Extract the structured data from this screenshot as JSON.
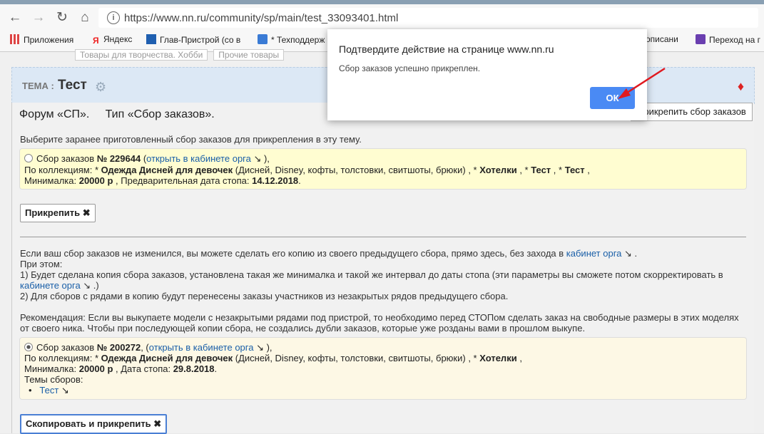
{
  "browser": {
    "url": "https://www.nn.ru/community/sp/main/test_33093401.html",
    "bookmarks": [
      "Приложения",
      "Яндекс",
      "Глав-Пристрой (со в",
      "* Техподдерж",
      "описани",
      "Переход на г"
    ]
  },
  "breadcrumbs": [
    "Товары для творчества. Хобби",
    "Прочие товары"
  ],
  "topic": {
    "label": "ТЕМА :",
    "title": "Тест"
  },
  "forum_line": "Форум «СП».     Тип «Сбор заказов».",
  "attach_top_button": "Прикрепить сбор заказов",
  "choose_text": "Выберите заранее приготовленный сбор заказов для прикрепления в эту тему.",
  "card1": {
    "l1a": "Сбор заказов ",
    "l1num": "№ 229644",
    "l1b": " (",
    "l1link": "открыть в кабинете орга",
    "l1c": " ↘ ),",
    "l2a": "По коллекциям: * ",
    "l2b1": "Одежда Дисней для девочек",
    "l2c": " (Дисней, Disney, кофты, толстовки, свитшоты, брюки) , * ",
    "l2b2": "Хотелки",
    "l2d": " , * ",
    "l2b3": "Тест",
    "l2e": " , * ",
    "l2b4": "Тест",
    "l2f": " ,",
    "l3a": "Минималка: ",
    "l3b1": "20000 р",
    "l3c": " , Предварительная дата стопа: ",
    "l3b2": "14.12.2018",
    "l3d": "."
  },
  "attach_button": "Прикрепить ✖",
  "copy_text": {
    "p1a": "Если ваш сбор заказов не изменился, вы можете сделать его копию из своего предыдущего сбора, прямо здесь, без захода в ",
    "p1link": "кабинет орга",
    "p1b": " ↘ .",
    "p2": "При этом:",
    "p3": "1) Будет сделана копия сбора заказов, установлена такая же минималка и такой же интервал до даты стопа (эти параметры вы сможете потом скорректировать в",
    "p4link": "кабинете орга",
    "p4b": " ↘ .)",
    "p5": "2) Для сборов с рядами в копию будут перенесены заказы участников из незакрытых рядов предыдущего сбора.",
    "p6": "Рекомендация: Если вы выкупаете модели с незакрытыми рядами под пристрой, то необходимо перед СТОПом сделать заказ на свободные размеры в этих моделях",
    "p7": "от своего ника. Чтобы при последующей копии сбора, не создались дубли заказов, которые уже розданы вами в прошлом выкупе."
  },
  "card2": {
    "l1a": "Сбор заказов ",
    "l1num": "№ 200272",
    "l1b": ", (",
    "l1link": "открыть в кабинете орга",
    "l1c": " ↘ ),",
    "l2a": "По коллекциям: * ",
    "l2b1": "Одежда Дисней для девочек",
    "l2c": " (Дисней, Disney, кофты, толстовки, свитшоты, брюки) , * ",
    "l2b2": "Хотелки",
    "l2d": " ,",
    "l3a": "Минималка: ",
    "l3b1": "20000 р",
    "l3c": " , Дата стопа: ",
    "l3b2": "29.8.2018",
    "l3d": ".",
    "l4": "Темы сборов:",
    "l5link": "Тест",
    "l5b": " ↘"
  },
  "copy_button": "Скопировать и прикрепить ✖",
  "dialog": {
    "title": "Подтвердите действие на странице www.nn.ru",
    "message": "Сбор заказов успешно прикреплен.",
    "ok": "ОК"
  },
  "colors": {
    "accent": "#4a8af4",
    "link": "#1a5fa8",
    "arrow": "#e0191f"
  }
}
